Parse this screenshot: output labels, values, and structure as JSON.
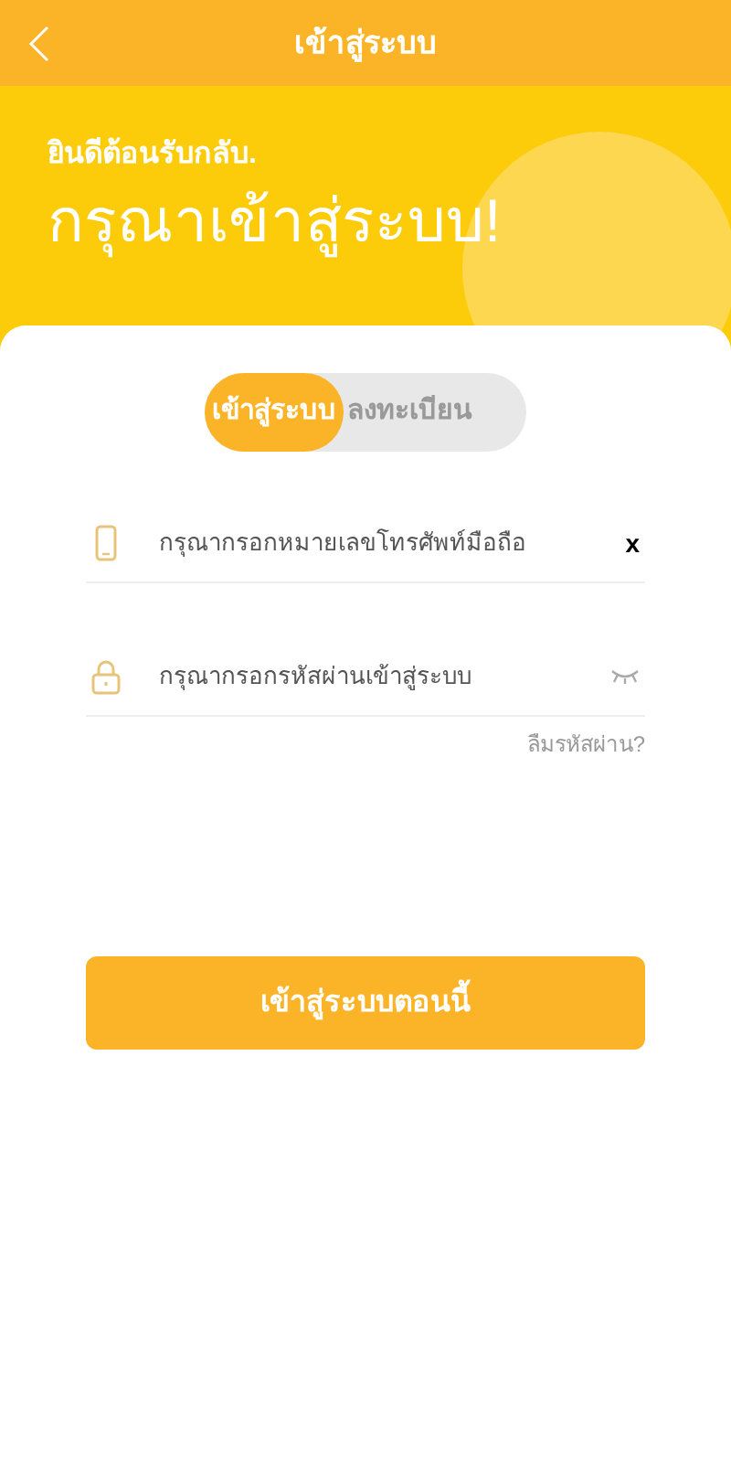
{
  "header": {
    "title": "เข้าสู่ระบบ"
  },
  "hero": {
    "greeting": "ยินดีต้อนรับกลับ.",
    "headline": "กรุณาเข้าสู่ระบบ!"
  },
  "tabs": [
    {
      "label": "เข้าสู่ระบบ",
      "selected": true
    },
    {
      "label": "ลงทะเบียน",
      "selected": false
    }
  ],
  "phone_field": {
    "placeholder": "กรุณากรอกหมายเลขโทรศัพท์มือถือ",
    "clear": "x"
  },
  "password_field": {
    "placeholder": "กรุณากรอกรหัสผ่านเข้าสู่ระบบ"
  },
  "forgot_link": "ลืมรหัสผ่าน?",
  "submit_button": "เข้าสู่ระบบตอนนี้"
}
